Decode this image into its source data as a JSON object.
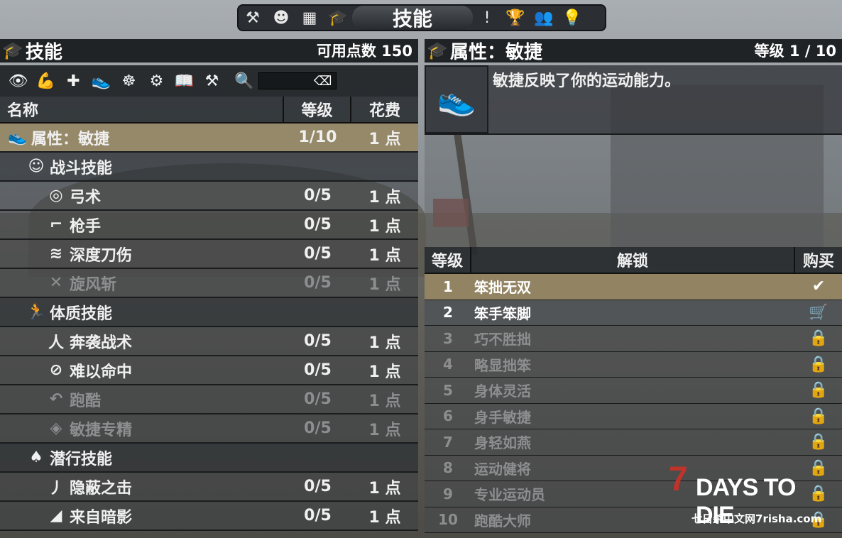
{
  "nav": {
    "title": "技能",
    "icons_left": [
      "hammer-icon",
      "character-icon",
      "map-icon",
      "skills-icon"
    ],
    "icons_right": [
      "exclamation-icon",
      "trophy-icon",
      "players-icon",
      "lightbulb-icon"
    ]
  },
  "left_header": {
    "title": "技能",
    "points": "可用点数 150"
  },
  "right_header": {
    "title": "属性：敏捷",
    "level": "等级 1 / 10"
  },
  "toolbar": {
    "icons": [
      "eye-icon",
      "strength-icon",
      "health-icon",
      "agility-icon",
      "brain-icon",
      "gear-icon",
      "book-icon",
      "hammer-icon"
    ],
    "search_placeholder": ""
  },
  "columns": {
    "name": "名称",
    "level": "等级",
    "cost": "花费"
  },
  "skills": [
    {
      "type": "selected",
      "icon": "👟",
      "name": "属性：敏捷",
      "level": "1/10",
      "cost": "1 点"
    },
    {
      "type": "cat",
      "icon": "☺",
      "name": "战斗技能",
      "level": "",
      "cost": ""
    },
    {
      "type": "item",
      "icon": "◎",
      "name": "弓术",
      "level": "0/5",
      "cost": "1 点"
    },
    {
      "type": "item",
      "icon": "⌐",
      "name": "枪手",
      "level": "0/5",
      "cost": "1 点"
    },
    {
      "type": "item",
      "icon": "≋",
      "name": "深度刀伤",
      "level": "0/5",
      "cost": "1 点"
    },
    {
      "type": "dim",
      "icon": "✕",
      "name": "旋风斩",
      "level": "0/5",
      "cost": "1 点"
    },
    {
      "type": "cat",
      "icon": "🏃",
      "name": "体质技能",
      "level": "",
      "cost": ""
    },
    {
      "type": "item",
      "icon": "⼈",
      "name": "奔袭战术",
      "level": "0/5",
      "cost": "1 点"
    },
    {
      "type": "item",
      "icon": "⊘",
      "name": "难以命中",
      "level": "0/5",
      "cost": "1 点"
    },
    {
      "type": "dim",
      "icon": "↶",
      "name": "跑酷",
      "level": "0/5",
      "cost": "1 点"
    },
    {
      "type": "dim",
      "icon": "◈",
      "name": "敏捷专精",
      "level": "0/5",
      "cost": "1 点"
    },
    {
      "type": "cat",
      "icon": "♠",
      "name": "潜行技能",
      "level": "",
      "cost": ""
    },
    {
      "type": "item",
      "icon": "⼃",
      "name": "隐蔽之击",
      "level": "0/5",
      "cost": "1 点"
    },
    {
      "type": "item",
      "icon": "◢",
      "name": "来自暗影",
      "level": "0/5",
      "cost": "1 点"
    }
  ],
  "info": {
    "description": "敏捷反映了你的运动能力。"
  },
  "unlock_columns": {
    "level": "等级",
    "unlock": "解锁",
    "buy": "购买"
  },
  "unlocks": [
    {
      "n": "1",
      "name": "笨拙无双",
      "state": "done",
      "sym": "✔"
    },
    {
      "n": "2",
      "name": "笨手笨脚",
      "state": "next",
      "sym": "🛒"
    },
    {
      "n": "3",
      "name": "巧不胜拙",
      "state": "locked",
      "sym": "🔒"
    },
    {
      "n": "4",
      "name": "略显拙笨",
      "state": "locked",
      "sym": "🔒"
    },
    {
      "n": "5",
      "name": "身体灵活",
      "state": "locked",
      "sym": "🔒"
    },
    {
      "n": "6",
      "name": "身手敏捷",
      "state": "locked",
      "sym": "🔒"
    },
    {
      "n": "7",
      "name": "身轻如燕",
      "state": "locked",
      "sym": "🔒"
    },
    {
      "n": "8",
      "name": "运动健将",
      "state": "locked",
      "sym": "🔒"
    },
    {
      "n": "9",
      "name": "专业运动员",
      "state": "locked",
      "sym": "🔒"
    },
    {
      "n": "10",
      "name": "跑酷大师",
      "state": "locked",
      "sym": "🔒"
    }
  ],
  "watermark": {
    "seven": "7",
    "title": "DAYS TO DIE",
    "subtitle": "七日杀中文网7risha.com"
  }
}
